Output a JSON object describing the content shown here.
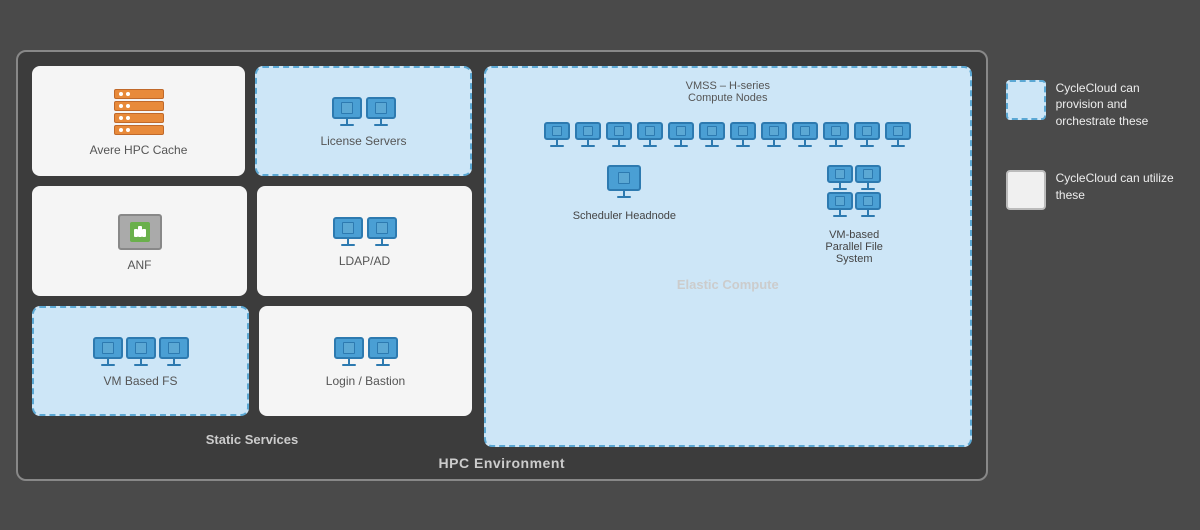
{
  "page": {
    "bg_color": "#4a4a4a"
  },
  "hpc_env": {
    "label": "HPC Environment",
    "border_color": "#888"
  },
  "static_services": {
    "label": "Static Services",
    "cards": [
      {
        "id": "avere-hpc-cache",
        "label": "Avere HPC Cache",
        "type": "avere",
        "dashed": false
      },
      {
        "id": "license-servers",
        "label": "License Servers",
        "type": "monitors-2",
        "dashed": true
      },
      {
        "id": "anf",
        "label": "ANF",
        "type": "anf",
        "dashed": false
      },
      {
        "id": "ldap-ad",
        "label": "LDAP/AD",
        "type": "monitors-2",
        "dashed": false
      },
      {
        "id": "vm-based-fs",
        "label": "VM Based FS",
        "type": "vm-fs",
        "dashed": true
      },
      {
        "id": "login-bastion",
        "label": "Login / Bastion",
        "type": "monitors-2-sm",
        "dashed": false
      }
    ]
  },
  "elastic_compute": {
    "label": "Elastic Compute",
    "vmss_label": "VMSS – H-series",
    "vmss_sublabel": "Compute Nodes",
    "scheduler_label": "Scheduler Headnode",
    "pfs_label": "VM-based\nParallel File\nSystem"
  },
  "legend": {
    "item1_text": "CycleCloud can provision and orchestrate these",
    "item2_text": "CycleCloud can utilize these"
  }
}
